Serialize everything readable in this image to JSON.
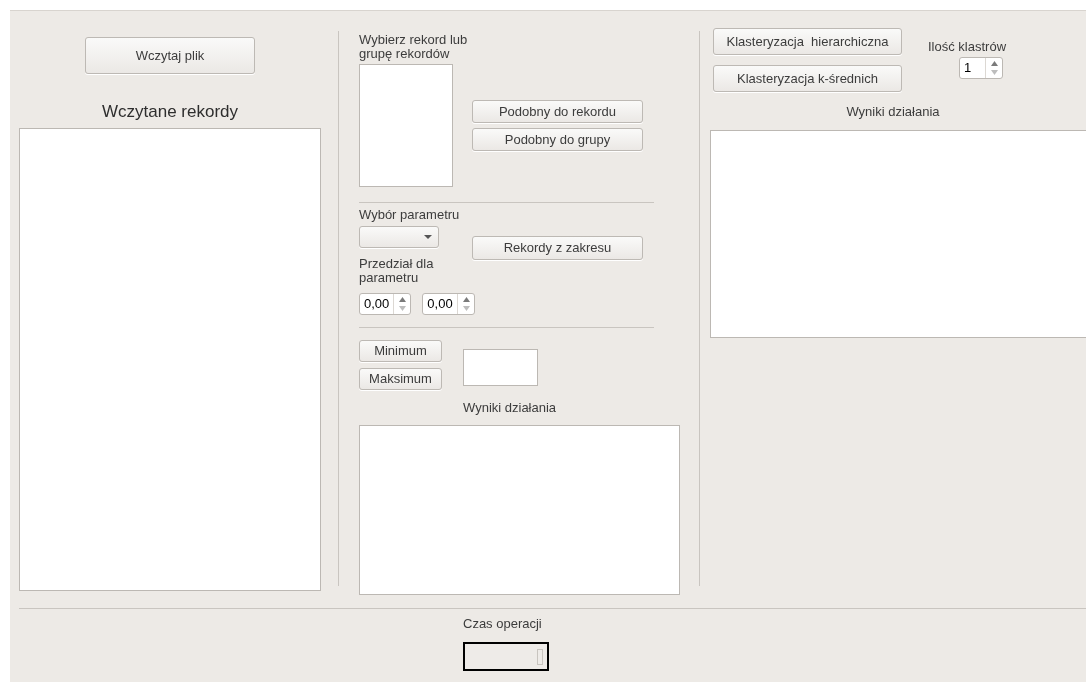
{
  "load_button": "Wczytaj plik",
  "loaded_records": {
    "title": "Wczytane rekordy"
  },
  "similarity": {
    "label": "Wybierz rekord lub grupę rekordów",
    "buttons": [
      "Podobny do rekordu",
      "Podobny do grupy"
    ]
  },
  "parameter": {
    "label": "Wybór parametru",
    "range_button": "Rekordy z zakresu",
    "range_label": "Przedział dla parametru",
    "range_from": "0,00",
    "range_to": "0,00"
  },
  "extremes": {
    "buttons": [
      "Minimum",
      "Maksimum"
    ],
    "results_label": "Wyniki działania"
  },
  "clustering": {
    "buttons": [
      "Klasteryzacja  hierarchiczna",
      "Klasteryzacja k-średnich"
    ],
    "count_label": "Ilość klastrów",
    "count": "1",
    "results_label": "Wyniki działania"
  },
  "footer": {
    "label": "Czas operacji"
  }
}
